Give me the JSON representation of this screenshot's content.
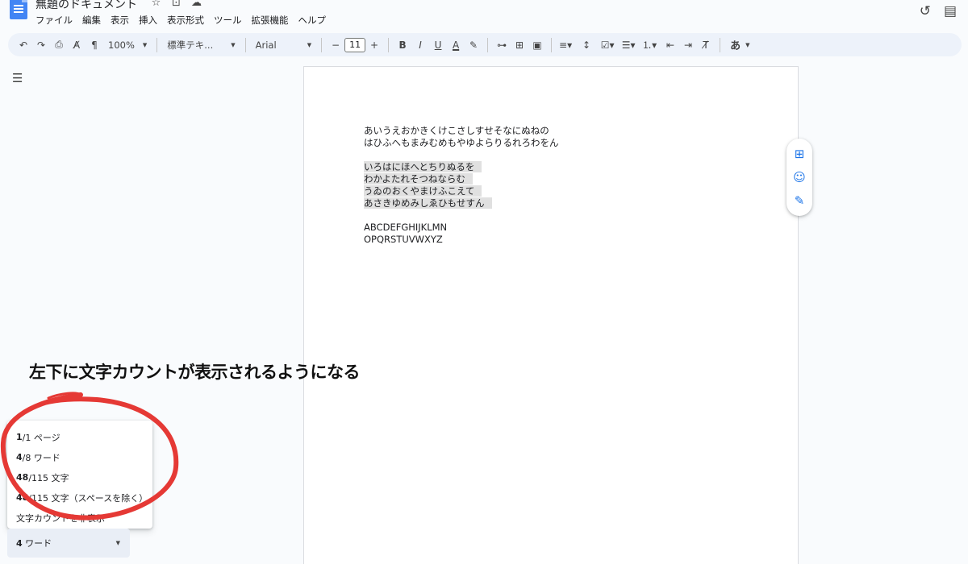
{
  "app": {
    "doc_title": "無題のドキュメント",
    "title_icons": [
      "star-icon",
      "move-folder-icon",
      "cloud-status-icon"
    ],
    "menu": [
      "ファイル",
      "編集",
      "表示",
      "挿入",
      "表示形式",
      "ツール",
      "拡張機能",
      "ヘルプ"
    ],
    "top_right_icons": [
      "history-icon",
      "comments-icon"
    ]
  },
  "toolbar": {
    "zoom": "100%",
    "style": "標準テキ...",
    "font": "Arial",
    "font_size": "11",
    "input_tool": "あ"
  },
  "document": {
    "para1": [
      "あいうえおかきくけこさしすせそなにぬねの",
      "はひふへもまみむめもやゆよらりるれろわをん"
    ],
    "para2_highlighted": [
      "いろはにほへとちりぬるを",
      "わかよたれそつねならむ",
      "うゐのおくやまけふこえて",
      "あさきゆめみしゑひもせすん"
    ],
    "para3": [
      "ABCDEFGHIJKLMN",
      "OPQRSTUVWXYZ"
    ]
  },
  "annotation": {
    "text": "左下に文字カウントが表示されるようになる",
    "circle_color": "#e53935"
  },
  "word_count": {
    "pages_num": "1",
    "pages_rest": "/1 ページ",
    "words_num": "4",
    "words_rest": "/8 ワード",
    "chars_num": "48",
    "chars_rest": "/115 文字",
    "chars_nospace_num": "48",
    "chars_nospace_rest": "/115 文字（スペースを除く）",
    "hide_label": "文字カウントを非表示",
    "pill_num": "4",
    "pill_rest": " ワード"
  },
  "colors": {
    "accent": "#1a73e8",
    "toolbar_bg": "#edf2fa",
    "page_bg": "#f9fbfd",
    "highlight": "#e0e0e0"
  }
}
